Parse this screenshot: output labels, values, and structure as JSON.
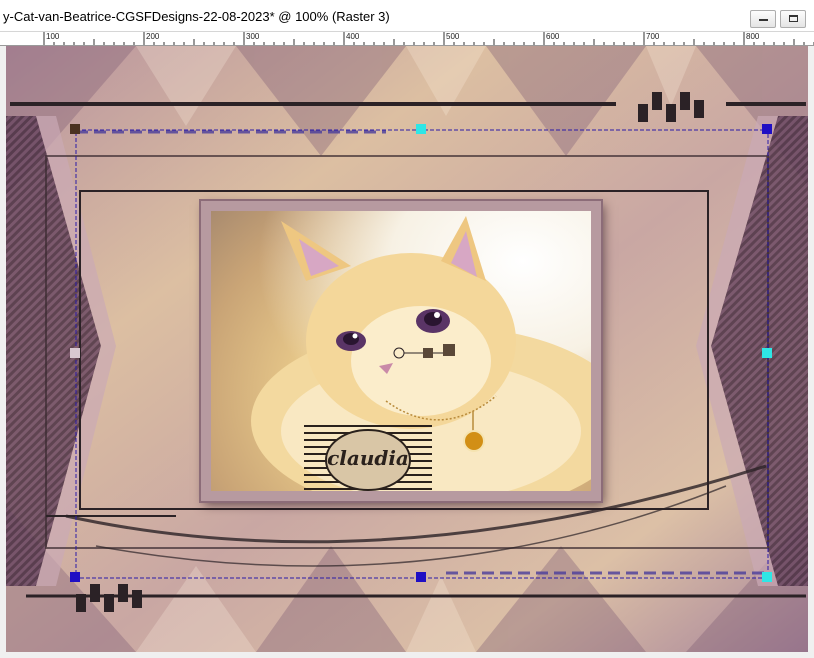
{
  "window": {
    "title": "y-Cat-van-Beatrice-CGSFDesigns-22-08-2023* @ 100% (Raster 3)",
    "minimize_icon": "minimize-icon",
    "maximize_icon": "restore-icon"
  },
  "ruler": {
    "labels": [
      "100",
      "200",
      "300",
      "400",
      "500",
      "600",
      "700",
      "800"
    ]
  },
  "canvas": {
    "zoom_percent": 100,
    "active_layer": "Raster 3",
    "selection_color": "#2a1aa8",
    "handle_color_blue": "#1f0fc4",
    "handle_color_cyan": "#2ee6e6"
  },
  "watermark": {
    "text": "claudia"
  },
  "colors": {
    "mauve": "#7b5a72",
    "dark_frame": "#2b2226",
    "sand": "#d9b99a"
  }
}
